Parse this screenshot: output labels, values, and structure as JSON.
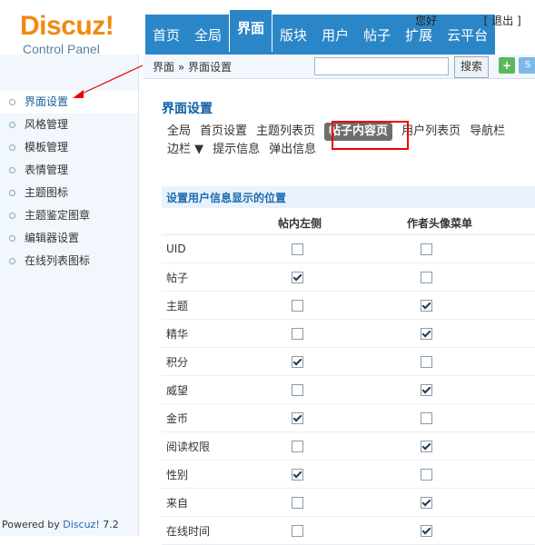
{
  "logo": {
    "brand": "Discuz!",
    "subtitle": "Control Panel"
  },
  "topnav": [
    "首页",
    "全局",
    "界面",
    "版块",
    "用户",
    "帖子",
    "扩展",
    "云平台"
  ],
  "topnav_active": 2,
  "topright": {
    "greeting": "您好",
    "logout": "[ 退出 ]"
  },
  "breadcrumb": "界面 » 界面设置",
  "search": {
    "value": "",
    "button": "搜索"
  },
  "add_button": "+",
  "more_button": "S",
  "sidebar": {
    "items": [
      "界面设置",
      "风格管理",
      "模板管理",
      "表情管理",
      "主题图标",
      "主题鉴定图章",
      "编辑器设置",
      "在线列表图标"
    ],
    "active": 0
  },
  "powered": {
    "prefix": "Powered by ",
    "name": "Discuz!",
    "version": " 7.2"
  },
  "page_title": "界面设置",
  "subnav": [
    "全局",
    "首页设置",
    "主题列表页",
    "帖子内容页",
    "用户列表页",
    "导航栏",
    "边栏 ▼",
    "提示信息",
    "弹出信息"
  ],
  "subnav_active": 3,
  "section_title": "设置用户信息显示的位置",
  "columns": [
    "帖内左侧",
    "作者头像菜单"
  ],
  "rows": [
    {
      "label": "UID",
      "left": false,
      "menu": false
    },
    {
      "label": "帖子",
      "left": true,
      "menu": false
    },
    {
      "label": "主题",
      "left": false,
      "menu": true
    },
    {
      "label": "精华",
      "left": false,
      "menu": true
    },
    {
      "label": "积分",
      "left": true,
      "menu": false
    },
    {
      "label": "威望",
      "left": false,
      "menu": true
    },
    {
      "label": "金币",
      "left": true,
      "menu": false
    },
    {
      "label": "阅读权限",
      "left": false,
      "menu": true
    },
    {
      "label": "性别",
      "left": true,
      "menu": false
    },
    {
      "label": "来自",
      "left": false,
      "menu": true
    },
    {
      "label": "在线时间",
      "left": false,
      "menu": true
    }
  ],
  "colors": {
    "nav_bg": "#2b86c7",
    "logo": "#f08a10",
    "title": "#0f5fa4",
    "highlight": "#e00000"
  }
}
